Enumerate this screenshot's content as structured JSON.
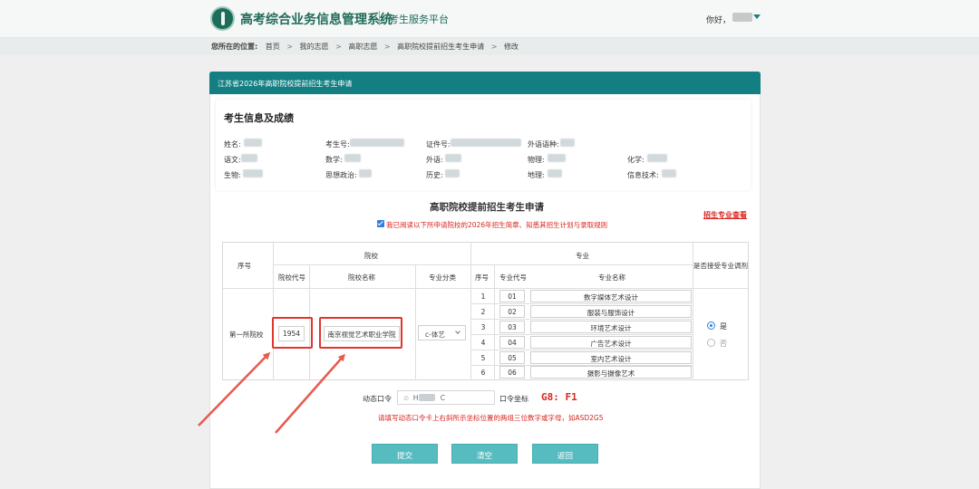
{
  "header": {
    "system_title": "高考综合业务信息管理系统",
    "platform": "考生服务平台",
    "greeting": "你好，"
  },
  "breadcrumb": {
    "prefix": "您所在的位置:",
    "items": [
      "首页",
      "我的志愿",
      "高职志愿",
      "高职院校提前招生考生申请",
      "修改"
    ]
  },
  "panel": {
    "title": "江苏省2026年高职院校提前招生考生申请"
  },
  "student_info": {
    "title": "考生信息及成绩",
    "fields": {
      "name": "姓名:",
      "exam_no": "考生号:",
      "id_no": "证件号:",
      "foreign_lang_type": "外语语种:",
      "chinese": "语文:",
      "math": "数学:",
      "foreign": "外语:",
      "physics": "物理:",
      "chemistry": "化学:",
      "biology": "生物:",
      "politics": "思想政治:",
      "history": "历史:",
      "geography": "地理:",
      "it": "信息技术:"
    }
  },
  "application": {
    "title": "高职院校提前招生考生申请",
    "link": "招生专业查看",
    "agree_text": "我已阅读以下所申请院校的2026年招生简章、知悉其招生计划与录取规则"
  },
  "table": {
    "headers": {
      "seq": "序号",
      "school_group": "院校",
      "school_code": "院校代号",
      "school_name": "院校名称",
      "major_category": "专业分类",
      "major_group": "专业",
      "major_seq": "序号",
      "major_code": "专业代号",
      "major_name": "专业名称",
      "accept_adjust": "是否接受专业调剂"
    },
    "row": {
      "label": "第一所院校",
      "school_code": "1954",
      "school_name": "南京视觉艺术职业学院",
      "category": "c-体艺",
      "majors": [
        {
          "seq": "1",
          "code": "01",
          "name": "数字媒体艺术设计"
        },
        {
          "seq": "2",
          "code": "02",
          "name": "服装与服饰设计"
        },
        {
          "seq": "3",
          "code": "03",
          "name": "环境艺术设计"
        },
        {
          "seq": "4",
          "code": "04",
          "name": "广告艺术设计"
        },
        {
          "seq": "5",
          "code": "05",
          "name": "室内艺术设计"
        },
        {
          "seq": "6",
          "code": "06",
          "name": "摄影与摄像艺术"
        }
      ],
      "adjust_yes": "是",
      "adjust_no": "否"
    }
  },
  "dynamic_code": {
    "label": "动态口令",
    "value_prefix": "H",
    "value_suffix": "C",
    "coord_label": "口令坐标",
    "coord_value": "G8: F1",
    "hint": "请填写动态口令卡上右斜所示坐标位置的两组三位数字或字母，如ASD2G5"
  },
  "buttons": {
    "submit": "提交",
    "clear": "清空",
    "back": "返回"
  },
  "colors": {
    "brand_teal": "#137f82",
    "button_teal": "#57bcc0",
    "alert_red": "#d8241e",
    "highlight_red": "#e2352c"
  }
}
